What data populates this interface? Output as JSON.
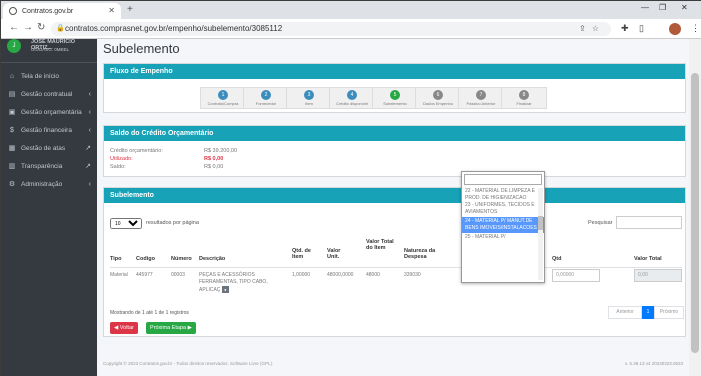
{
  "browser": {
    "tab_title": "Contratos.gov.br",
    "url": "contratos.comprasnet.gov.br/empenho/subelemento/3085112"
  },
  "sidebar": {
    "user_name": "JOSE MAURICIO ORTIZ...",
    "user_unit": "UG/UASG: 0MEEL",
    "items": [
      {
        "label": "Tela de início",
        "icon": "home-icon"
      },
      {
        "label": "Gestão contratual",
        "icon": "file-icon"
      },
      {
        "label": "Gestão orçamentária",
        "icon": "money-icon"
      },
      {
        "label": "Gestão financeira",
        "icon": "dollar-icon"
      },
      {
        "label": "Gestão de atas",
        "icon": "document-icon"
      },
      {
        "label": "Transparência",
        "icon": "book-icon"
      },
      {
        "label": "Administração",
        "icon": "cogs-icon"
      }
    ]
  },
  "page": {
    "title": "Subelemento"
  },
  "fluxo": {
    "header": "Fluxo de Empenho",
    "steps": [
      {
        "n": "1",
        "label": "Contrato/Compra",
        "color": "#3c8dbc"
      },
      {
        "n": "2",
        "label": "Fornecedor",
        "color": "#3c8dbc"
      },
      {
        "n": "3",
        "label": "Item",
        "color": "#3c8dbc"
      },
      {
        "n": "4",
        "label": "Crédito disponível",
        "color": "#3c8dbc"
      },
      {
        "n": "5",
        "label": "Subelemento",
        "color": "#28a745"
      },
      {
        "n": "6",
        "label": "Dados Empenho",
        "color": "#888888"
      },
      {
        "n": "7",
        "label": "Passivo Anterior",
        "color": "#888888"
      },
      {
        "n": "8",
        "label": "Finalizar",
        "color": "#888888"
      }
    ]
  },
  "saldo": {
    "header": "Saldo do Crédito Orçamentário",
    "rows": [
      {
        "label": "Crédito orçamentário:",
        "value": "R$ 39.200,00"
      },
      {
        "label": "Utilizado:",
        "value": "R$ 0,00"
      },
      {
        "label": "Saldo:",
        "value": "R$ 0,00"
      }
    ]
  },
  "sub": {
    "header": "Subelemento",
    "length_value": "10",
    "length_label": "resultados por página",
    "search_label": "Pesquisar",
    "columns": [
      "Tipo",
      "Codigo",
      "Número",
      "Descrição",
      "Qtd. de Item",
      "Valor Unit.",
      "Valor Total do Item",
      "Natureza da Despesa",
      "Qtd",
      "Valor Total"
    ],
    "row": {
      "tipo": "Material",
      "codigo": "445977",
      "numero": "00003",
      "descricao": "PEÇAS E ACESSÓRIOS FERRAMENTAS, TIPO CABO, APLICAÇ",
      "qtd_item": "1,00000",
      "valor_unit": "48000,0000",
      "valor_total_item": "48000",
      "natureza": "339030",
      "select_value": "00 - MATERIAL DE CO...",
      "qtd_placeholder": "0,00000",
      "valor_total_placeholder": "0,00"
    },
    "info": "Mostrando de 1 até 1 de 1 registros",
    "pag_prev": "Anterior",
    "pag_cur": "1",
    "pag_next": "Próximo",
    "btn_back": "Voltar",
    "btn_next": "Próxima Etapa"
  },
  "dropdown": {
    "options": [
      "22 - MATERIAL DE LIMPEZA E PROD. DE HIGIENIZACAO",
      "23 - UNIFORMES, TECIDOS E AVIAMENTOS",
      "24 - MATERIAL P/ MANUT.DE BENS IMOVEIS/INSTALACOES",
      "25 - MATERIAL P/"
    ],
    "selected_index": 2
  },
  "footer": {
    "left": "Copyright © 2023 Contratos.gov.br - Todos direitos reservados. Software Livre (GPL).",
    "right": "v. 5.39.13 v4 20230323.0633"
  }
}
